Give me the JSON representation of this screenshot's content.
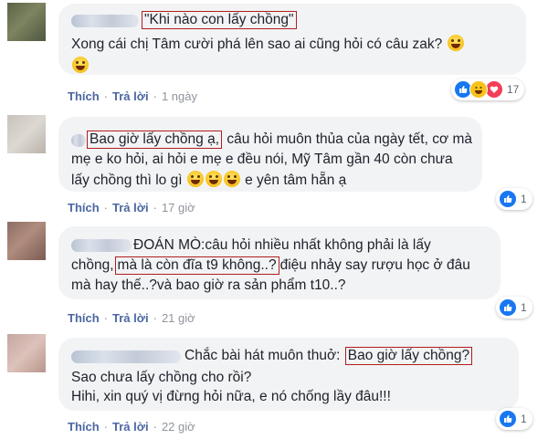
{
  "comments": [
    {
      "line1_boxed": "\"Khi nào con lấy chồng\"",
      "line2": "Xong cái chị Tâm cười phá lên sao ai cũng hỏi có câu zak?",
      "like": "Thích",
      "reply": "Trả lời",
      "time": "1 ngày",
      "reaction_count": "17"
    },
    {
      "line1_boxed": "Bao giờ lấy chồng ạ,",
      "line1_rest": " câu hỏi muôn thủa của ngày tết, cơ mà",
      "line2": "mẹ e ko hỏi, ai hỏi e mẹ e đều nói, Mỹ Tâm gần 40 còn chưa",
      "line3_a": "lấy chồng thì lo gì",
      "line3_b": " e yên tâm hẵn ạ",
      "like": "Thích",
      "reply": "Trả lời",
      "time": "17 giờ",
      "reaction_count": "1"
    },
    {
      "line1": "ĐOÁN MÒ:câu hỏi nhiều nhất không phải là lấy",
      "line2_a": "chồng,",
      "line2_boxed": "mà là còn đĩa t9 không..?",
      "line2_b": "điệu nhảy say rượu học ở đâu",
      "line3": "mà hay thế..?và bao giờ ra sản phẩm t10..?",
      "like": "Thích",
      "reply": "Trả lời",
      "time": "21 giờ",
      "reaction_count": "1"
    },
    {
      "line1_a": "Chắc bài hát muôn thuở:",
      "line1_boxed": "Bao giờ lấy chồng?",
      "line2": "Sao chưa lấy chồng cho rồi?",
      "line3": "Hihi, xin quý vị đừng hỏi nữa, e nó chống lầy đâu!!!",
      "like": "Thích",
      "reply": "Trả lời",
      "time": "22 giờ",
      "reaction_count": "1"
    }
  ],
  "colors": {
    "bubble": "#f2f3f5",
    "highlight_box": "#b01e1e",
    "link": "#4b67a1",
    "like_blue": "#1877f2"
  },
  "icons": [
    "avatar",
    "laugh-emoji-icon",
    "like-reaction-icon",
    "haha-reaction-icon",
    "love-reaction-icon"
  ]
}
